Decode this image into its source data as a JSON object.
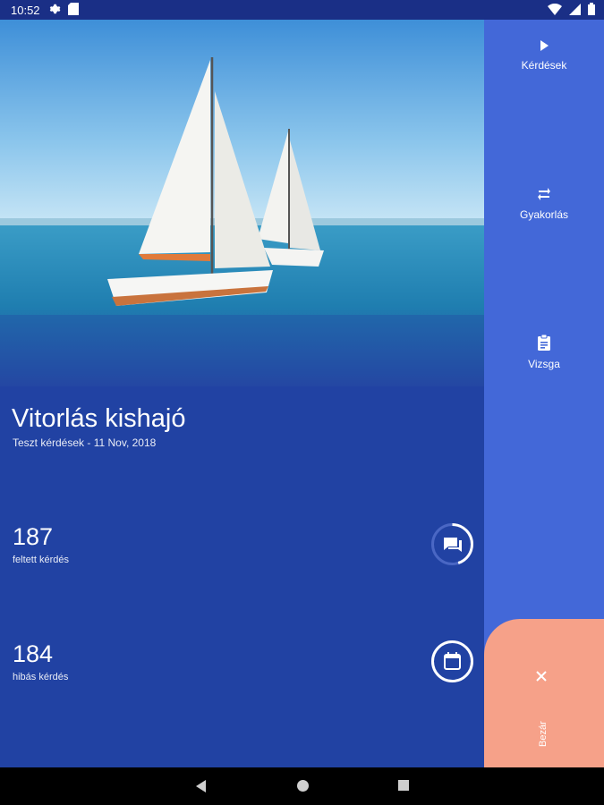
{
  "status": {
    "time": "10:52",
    "left_icons": [
      "gear-icon",
      "sd-card-icon"
    ],
    "right_icons": [
      "wifi-icon",
      "signal-icon",
      "battery-icon"
    ]
  },
  "header": {
    "title": "Vitorlás kishajó",
    "subtitle": "Teszt kérdések - 11 Nov, 2018"
  },
  "stats": [
    {
      "value": "187",
      "label": "feltett kérdés",
      "icon": "chat-icon",
      "progress": 0.45
    },
    {
      "value": "184",
      "label": "hibás kérdés",
      "icon": "calendar-icon",
      "progress": 1.0
    }
  ],
  "menu": {
    "items": [
      {
        "label": "Kérdések",
        "icon": "play-icon"
      },
      {
        "label": "Gyakorlás",
        "icon": "repeat-icon"
      },
      {
        "label": "Vizsga",
        "icon": "clipboard-icon"
      }
    ],
    "close_label": "Bezár",
    "close_icon": "close-icon"
  },
  "colors": {
    "main_bg": "#2142a3",
    "side_bg": "#4368d8",
    "close_bg": "#f6a189",
    "status_bg": "#1a2f86"
  },
  "android_nav": [
    "back-icon",
    "home-icon",
    "recents-icon"
  ]
}
